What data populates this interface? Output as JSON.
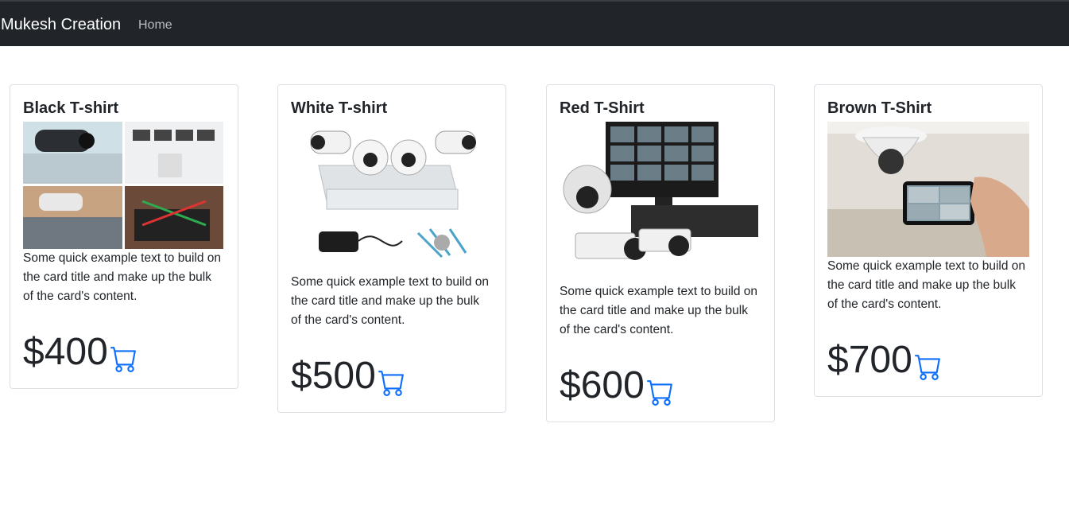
{
  "navbar": {
    "brand": "Mukesh Creation",
    "links": [
      "Home"
    ]
  },
  "colors": {
    "navbar": "#212529",
    "accent": "#0d6efd",
    "text": "#212529"
  },
  "products": [
    {
      "title": "Black T-shirt",
      "text": "Some quick example text to build on the card title and make up the bulk of the card's content.",
      "price": "$400",
      "image": "cctv-collage-image"
    },
    {
      "title": "White T-shirt",
      "text": "Some quick example text to build on the card title and make up the bulk of the card's content.",
      "price": "$500",
      "image": "cctv-kit-image"
    },
    {
      "title": "Red T-Shirt",
      "text": "Some quick example text to build on the card title and make up the bulk of the card's content.",
      "price": "$600",
      "image": "cctv-monitor-image"
    },
    {
      "title": "Brown T-Shirt",
      "text": "Some quick example text to build on the card title and make up the bulk of the card's content.",
      "price": "$700",
      "image": "dome-camera-phone-image"
    }
  ],
  "icons": {
    "cart": "cart-icon"
  }
}
